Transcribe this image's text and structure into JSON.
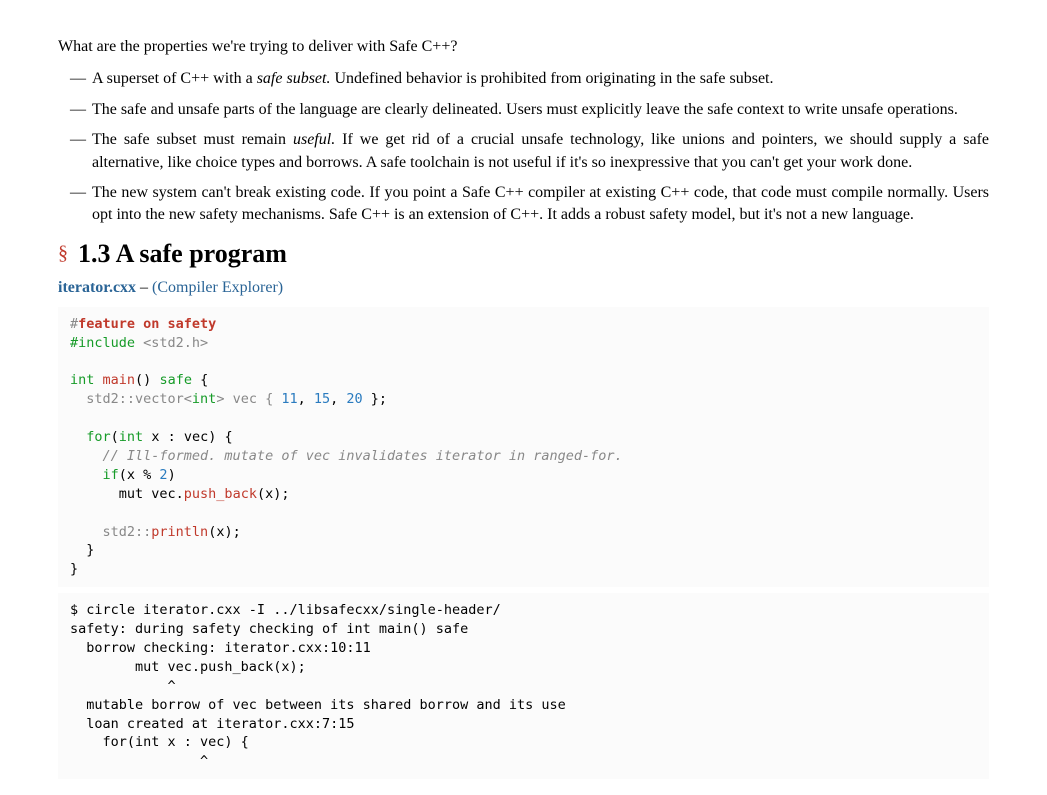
{
  "intro": "What are the properties we're trying to deliver with Safe C++?",
  "props": {
    "p1a": "A superset of C++ with a ",
    "p1b": "safe subset.",
    "p1c": " Undefined behavior is prohibited from originating in the safe subset.",
    "p2": "The safe and unsafe parts of the language are clearly delineated. Users must explicitly leave the safe context to write unsafe operations.",
    "p3a": "The safe subset must remain ",
    "p3b": "useful.",
    "p3c": " If we get rid of a crucial unsafe technology, like unions and pointers, we should supply a safe alternative, like choice types and borrows. A safe toolchain is not useful if it's so inexpressive that you can't get your work done.",
    "p4": "The new system can't break existing code. If you point a Safe C++ compiler at existing C++ code, that code must compile normally. Users opt into the new safety mechanisms. Safe C++ is an extension of C++. It adds a robust safety model, but it's not a new language."
  },
  "section": {
    "symbol": "§",
    "title": "1.3  A safe program"
  },
  "srcline": {
    "fname": "iterator.cxx",
    "dash": " – ",
    "explorer": "(Compiler Explorer)"
  },
  "code": {
    "l1a": "#",
    "l1b": "feature on safety",
    "l2a": "#include",
    "l2b": " <std2.h>",
    "blank1": "",
    "l3a": "int",
    "l3b": " ",
    "l3c": "main",
    "l3d": "() ",
    "l3e": "safe",
    "l3f": " {",
    "l4a": "  std2::vector<",
    "l4b": "int",
    "l4c": "> vec { ",
    "l4d": "11",
    "l4e": ", ",
    "l4f": "15",
    "l4g": ", ",
    "l4h": "20",
    "l4i": " };",
    "blank2": "",
    "l5a": "  ",
    "l5b": "for",
    "l5c": "(",
    "l5d": "int",
    "l5e": " x : vec) {",
    "l6": "    // Ill-formed. mutate of vec invalidates iterator in ranged-for.",
    "l7a": "    ",
    "l7b": "if",
    "l7c": "(x % ",
    "l7d": "2",
    "l7e": ")",
    "l8a": "      mut vec.",
    "l8b": "push_back",
    "l8c": "(x);",
    "blank3": "",
    "l9a": "    std2::",
    "l9b": "println",
    "l9c": "(x);",
    "l10": "  }",
    "l11": "}"
  },
  "out": {
    "o1": "$ circle iterator.cxx -I ../libsafecxx/single-header/",
    "o2": "safety: during safety checking of int main() safe",
    "o3": "  borrow checking: iterator.cxx:10:11",
    "o4": "        mut vec.push_back(x); ",
    "o5": "            ^",
    "o6": "  mutable borrow of vec between its shared borrow and its use",
    "o7": "  loan created at iterator.cxx:7:15",
    "o8": "    for(int x : vec) { ",
    "o9": "                ^"
  }
}
